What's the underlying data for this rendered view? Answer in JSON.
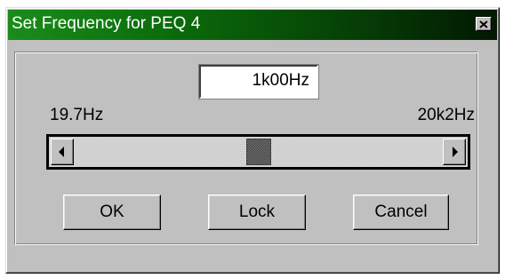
{
  "window": {
    "title": "Set Frequency for PEQ 4",
    "close_icon": "close-icon"
  },
  "frequency": {
    "value": "1k00Hz",
    "min_label": "19.7Hz",
    "max_label": "20k2Hz"
  },
  "slider": {
    "position_fraction": 0.5,
    "left_icon": "arrow-left-icon",
    "right_icon": "arrow-right-icon"
  },
  "buttons": {
    "ok": "OK",
    "lock": "Lock",
    "cancel": "Cancel"
  },
  "colors": {
    "titlebar_start": "#1a8c1a",
    "titlebar_end": "#021802",
    "face": "#c0c0c0"
  }
}
